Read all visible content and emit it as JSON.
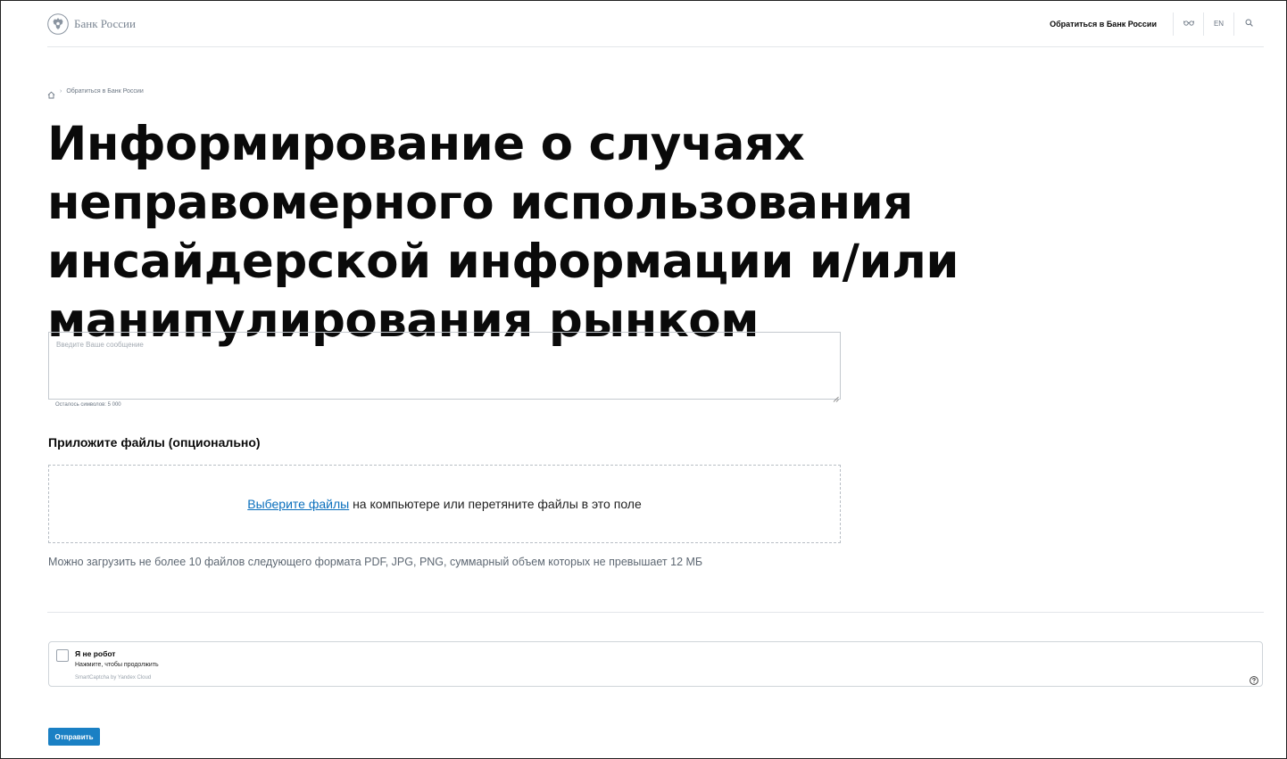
{
  "header": {
    "logo_text": "Банк России",
    "contact_label": "Обратиться в Банк России",
    "lang_label": "EN"
  },
  "breadcrumb": {
    "current": "Обратиться в Банк России"
  },
  "page": {
    "title": "Информирование о случаях неправомерного использования инсайдерской информации и/или манипулирования рынком"
  },
  "form": {
    "message_placeholder": "Введите Ваше сообщение",
    "char_counter": "Осталось символов: 5 000",
    "attach_heading": "Приложите файлы (опционально)",
    "dropzone_link": "Выберите файлы",
    "dropzone_text": " на компьютере или перетяните файлы в это поле",
    "upload_note": "Можно загрузить не более 10 файлов следующего формата PDF, JPG, PNG, суммарный объем которых не превышает 12 МБ",
    "submit_label": "Отправить"
  },
  "captcha": {
    "title": "Я не робот",
    "subtitle": "Нажмите, чтобы продолжить",
    "brand": "SmartCaptcha by Yandex Cloud"
  },
  "icons": {
    "logo": "eagle-emblem-icon",
    "accessibility": "glasses-icon",
    "search": "search-icon",
    "home": "home-icon",
    "help": "question-icon"
  },
  "colors": {
    "accent": "#1a80c4",
    "link": "#0a6fbd"
  }
}
